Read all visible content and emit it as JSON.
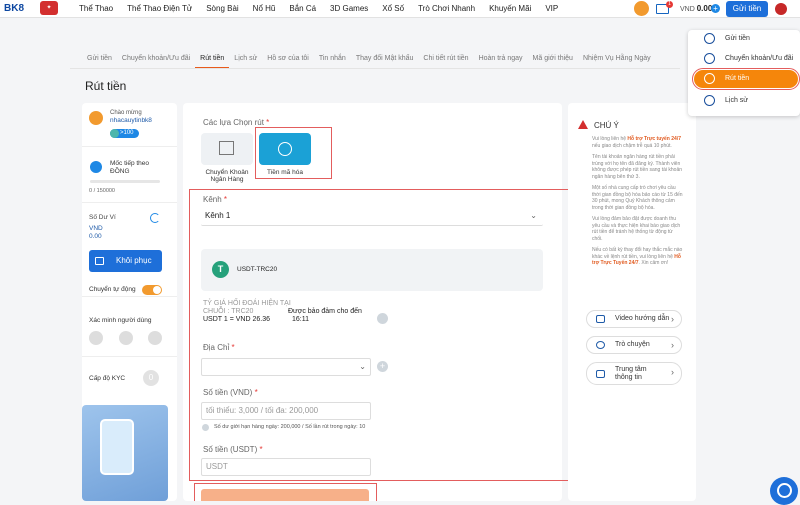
{
  "topbar": {
    "brand": "BK8",
    "nav": [
      "Thể Thao",
      "Thể Thao Điện Tử",
      "Sòng Bài",
      "Nổ Hũ",
      "Bắn Cá",
      "3D Games",
      "Xổ Số",
      "Trò Chơi Nhanh",
      "Khuyến Mãi",
      "VIP"
    ],
    "mail_badge": "1",
    "balance_currency": "VND",
    "balance_value": "0.00",
    "deposit_label": "Gửi tiền"
  },
  "dropdown": [
    "Gửi tiền",
    "Chuyển khoản/Ưu đãi",
    "Rút tiền",
    "Lịch sử"
  ],
  "tabs": [
    "Gửi tiền",
    "Chuyển khoản/Ưu đãi",
    "Rút tiền",
    "Lịch sử",
    "Hồ sơ của tôi",
    "Tin nhắn",
    "Thay đổi Mật khẩu",
    "Chi tiết rút tiền",
    "Hoàn trả ngay",
    "Mã giới thiệu",
    "Nhiệm Vụ Hằng Ngày"
  ],
  "page_title": "Rút tiền",
  "left": {
    "welcome": "Chào mừng",
    "username": "nhacauytinbk8",
    "vip_badge": ">100",
    "milestone": "Mốc tiếp theo",
    "milestone_unit": "ĐỒNG",
    "progress": "0 / 150000",
    "progress_fraction": 0,
    "balance_label": "Số Dư Ví",
    "balance_currency": "VND",
    "balance_value": "0.00",
    "restore_label": "Khôi phục",
    "auto_transfer": "Chuyển tự động",
    "verify_label": "Xác minh người dùng",
    "kyc_label": "Cấp độ KYC",
    "kyc_level": "0"
  },
  "main": {
    "options_label": "Các lựa Chọn rút",
    "option_bank": "Chuyển Khoản Ngân Hàng",
    "option_crypto": "Tiền mã hóa",
    "channel_label": "Kênh",
    "channel_value": "Kênh 1",
    "coin_name": "USDT-TRC20",
    "rate_title": "TỶ GIÁ HỐI ĐOÁI HIỆN TẠI",
    "chain": "CHUỖI : TRC20",
    "rate_value": "USDT 1 = VND 26.36",
    "guarantee_label": "Được bảo đảm cho đến",
    "guarantee_time": "16:11",
    "address_label": "Địa Chỉ",
    "amount_vnd_label": "Số tiền (VND)",
    "amount_placeholder": "tối thiểu: 3,000 / tối đa: 200,000",
    "limit_note": "Số dư giới hạn hàng ngày: 200,000 / Số lần rút trong ngày: 10",
    "amount_usdt_label": "Số tiền (USDT)",
    "usdt_placeholder": "USDT"
  },
  "right": {
    "notice_title": "CHÚ Ý",
    "notes": [
      [
        "Vui lòng liên hệ ",
        "Hỗ trợ Trực tuyến 24/7",
        " nếu giao dịch chậm trễ quá 10 phút."
      ],
      [
        "Tên tài khoản ngân hàng rút tiền phải trùng với họ tên đã đăng ký. Thành viên không được phép rút tiền sang tài khoản ngân hàng bên thứ 3."
      ],
      [
        "Một số nhà cung cấp trò chơi yêu cầu thời gian đồng bộ hóa bảo cáo từ 15 đến 30 phút, mong Quý Khách thông cảm trong thời gian đồng bộ hóa."
      ],
      [
        "Vui lòng đảm bảo đặt được doanh thu yêu cầu và thực hiện khai báo giao dịch rút tiền để tránh hệ thống từ động từ chối."
      ],
      [
        "Nếu có bất kỳ thay đổi hay thắc mắc nào khác về lệnh rút tiền, vui lòng liên hệ ",
        "Hỗ trợ Trực Tuyến 24/7",
        ". Xin cảm ơn!"
      ]
    ],
    "video_guide": "Video hướng dẫn",
    "chat": "Trò chuyện",
    "help_center": "Trung tâm thông tin"
  }
}
